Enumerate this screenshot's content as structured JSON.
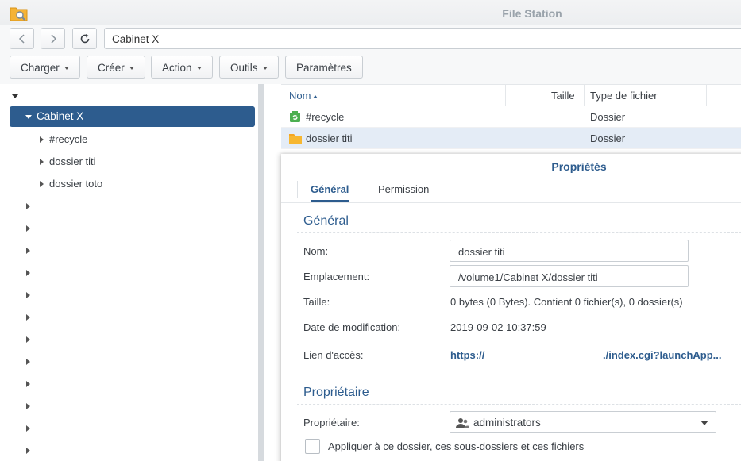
{
  "window": {
    "title": "File Station",
    "app_icon": "folder-search-icon"
  },
  "nav": {
    "back_icon": "chevron-left-icon",
    "forward_icon": "chevron-right-icon",
    "refresh_icon": "refresh-icon",
    "path": "Cabinet X"
  },
  "toolbar": {
    "upload": "Charger",
    "create": "Créer",
    "action": "Action",
    "tools": "Outils",
    "settings": "Paramètres"
  },
  "tree": {
    "selected": "Cabinet X",
    "children": [
      "#recycle",
      "dossier titi",
      "dossier toto"
    ],
    "collapsed_count": 12
  },
  "filelist": {
    "columns": {
      "name": "Nom",
      "size": "Taille",
      "type": "Type de fichier"
    },
    "rows": [
      {
        "name": "#recycle",
        "size": "",
        "type": "Dossier",
        "icon": "recycle-folder-icon"
      },
      {
        "name": "dossier titi",
        "size": "",
        "type": "Dossier",
        "icon": "folder-icon"
      }
    ]
  },
  "properties": {
    "title": "Propriétés",
    "tabs": [
      "Général",
      "Permission"
    ],
    "general_section": "Général",
    "fields": {
      "name_label": "Nom:",
      "name_value": "dossier titi",
      "location_label": "Emplacement:",
      "location_value": "/volume1/Cabinet X/dossier titi",
      "size_label": "Taille:",
      "size_value": "0 bytes (0 Bytes). Contient 0 fichier(s), 0 dossier(s)",
      "modified_label": "Date de modification:",
      "modified_value": "2019-09-02 10:37:59",
      "link_label": "Lien d'accès:",
      "link_prefix": "https://",
      "link_suffix": "./index.cgi?launchApp..."
    },
    "owner_section": "Propriétaire",
    "owner_label": "Propriétaire:",
    "owner_value": "administrators",
    "apply_label": "Appliquer à ce dossier, ces sous-dossiers et ces fichiers"
  },
  "colors": {
    "accent": "#2d5c8e",
    "selection": "#e4ecf6",
    "folder": "#f5a623",
    "recycle": "#4caf50"
  }
}
